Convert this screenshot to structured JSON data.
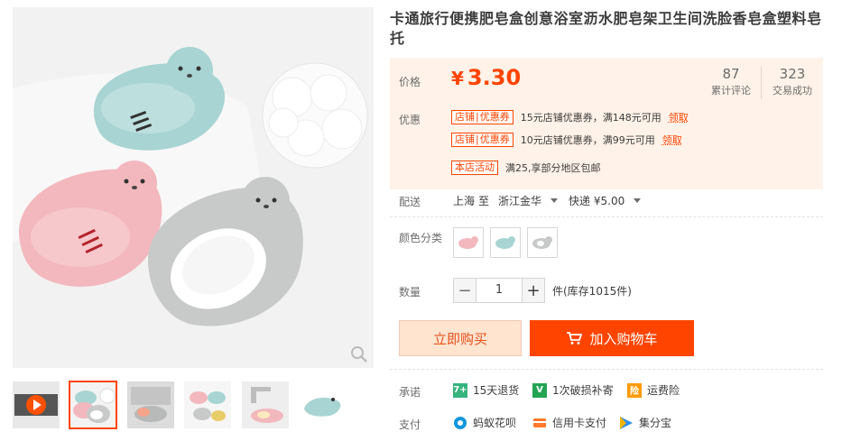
{
  "product": {
    "title": "卡通旅行便携肥皂盒创意浴室沥水肥皂架卫生间洗脸香皂盒塑料皂托"
  },
  "price": {
    "label": "价格",
    "currency": "¥",
    "value": "3.30",
    "reviews_count": "87",
    "reviews_label": "累计评论",
    "sales_count": "323",
    "sales_label": "交易成功"
  },
  "promo": {
    "label": "优惠",
    "coupons": [
      {
        "tag_a": "店铺",
        "tag_b": "优惠券",
        "text": "15元店铺优惠券，满148元可用",
        "action": "领取"
      },
      {
        "tag_a": "店铺",
        "tag_b": "优惠券",
        "text": "10元店铺优惠券，满99元可用",
        "action": "领取"
      }
    ],
    "activity_tag": "本店活动",
    "activity_text": "满25,享部分地区包邮"
  },
  "shipping": {
    "label": "配送",
    "from": "上海",
    "to_word": "至",
    "dest": "浙江金华",
    "method": "快递 ¥5.00"
  },
  "color": {
    "label": "颜色分类",
    "options": [
      "pink",
      "blue",
      "gray"
    ]
  },
  "quantity": {
    "label": "数量",
    "minus": "−",
    "value": "1",
    "plus": "+",
    "stock": "件(库存1015件)"
  },
  "buttons": {
    "buy_now": "立即购买",
    "add_cart": "加入购物车"
  },
  "promise": {
    "label": "承诺",
    "items": [
      {
        "icon": "7天",
        "text": "15天退货",
        "color": "#36b37e"
      },
      {
        "icon": "V",
        "text": "1次破损补寄",
        "color": "#23a455"
      },
      {
        "icon": "险",
        "text": "运费险",
        "color": "#ff9a00"
      }
    ]
  },
  "payment": {
    "label": "支付",
    "items": [
      {
        "text": "蚂蚁花呗",
        "color": "#1296db"
      },
      {
        "text": "信用卡支付",
        "color": "#ff7a2a"
      },
      {
        "text": "集分宝",
        "color": "#2f8fe8"
      }
    ]
  },
  "colors": {
    "accent": "#ff4400",
    "price_bg": "#fff2e8",
    "buy_bg": "#ffe4d0"
  }
}
